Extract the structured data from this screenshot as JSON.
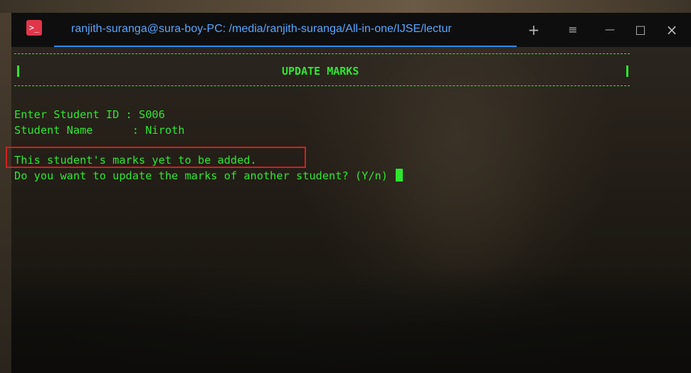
{
  "window": {
    "app_icon_glyph": ">_",
    "tab_title": "ranjith-suranga@sura-boy-PC: /media/ranjith-suranga/All-in-one/IJSE/lectur",
    "controls": {
      "new_tab": "+",
      "menu": "≡",
      "minimize": "—",
      "maximize": "□",
      "close": "×"
    }
  },
  "terminal": {
    "header_title": "UPDATE MARKS",
    "student_id_label": "Enter Student ID : ",
    "student_id_value": "S006",
    "student_name_label": "Student Name      : ",
    "student_name_value": "Niroth",
    "message": "This student's marks yet to be added.",
    "prompt": "Do you want to update the marks of another student? (Y/n) "
  },
  "colors": {
    "terminal_text": "#2ee62e",
    "tab_title": "#58a6ff",
    "highlight_box": "#d21f1f",
    "app_icon": "#e0364a"
  }
}
